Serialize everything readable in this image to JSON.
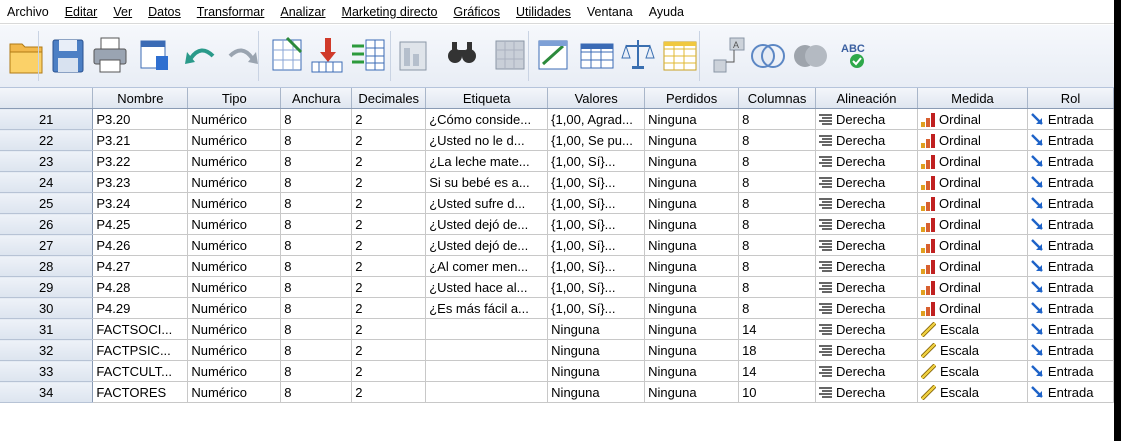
{
  "menu": [
    {
      "label": "Archivo",
      "ul": false
    },
    {
      "label": "Editar",
      "ul": true
    },
    {
      "label": "Ver",
      "ul": true
    },
    {
      "label": "Datos",
      "ul": true
    },
    {
      "label": "Transformar",
      "ul": true
    },
    {
      "label": "Analizar",
      "ul": true
    },
    {
      "label": "Marketing directo",
      "ul": true
    },
    {
      "label": "Gráficos",
      "ul": true
    },
    {
      "label": "Utilidades",
      "ul": true
    },
    {
      "label": "Ventana",
      "ul": false
    },
    {
      "label": "Ayuda",
      "ul": false
    }
  ],
  "toolbar": [
    "open-folder-icon",
    "save-icon",
    "print-icon",
    "dialog-recall-icon",
    "undo-icon",
    "redo-icon",
    "go-to-case-icon",
    "go-to-variable-icon",
    "variables-icon",
    "run-descriptive-icon",
    "find-icon",
    "insert-cases-icon",
    "insert-variable-icon",
    "split-file-icon",
    "weight-cases-icon",
    "select-cases-icon",
    "value-labels-icon",
    "use-variable-sets-icon",
    "show-all-variables-icon",
    "spell-check-icon"
  ],
  "grid": {
    "headers": [
      "",
      "Nombre",
      "Tipo",
      "Anchura",
      "Decimales",
      "Etiqueta",
      "Valores",
      "Perdidos",
      "Columnas",
      "Alineación",
      "Medida",
      "Rol"
    ],
    "rows": [
      {
        "n": "21",
        "nombre": "P3.20",
        "tipo": "Numérico",
        "anchura": "8",
        "decimales": "2",
        "etiqueta": "¿Cómo conside...",
        "valores": "{1,00, Agrad...",
        "perdidos": "Ninguna",
        "columnas": "8",
        "alineacion": "Derecha",
        "medida": "Ordinal",
        "rol": "Entrada"
      },
      {
        "n": "22",
        "nombre": "P3.21",
        "tipo": "Numérico",
        "anchura": "8",
        "decimales": "2",
        "etiqueta": "¿Usted no le d...",
        "valores": "{1,00, Se pu...",
        "perdidos": "Ninguna",
        "columnas": "8",
        "alineacion": "Derecha",
        "medida": "Ordinal",
        "rol": "Entrada"
      },
      {
        "n": "23",
        "nombre": "P3.22",
        "tipo": "Numérico",
        "anchura": "8",
        "decimales": "2",
        "etiqueta": "¿La leche mate...",
        "valores": "{1,00, Sí}...",
        "perdidos": "Ninguna",
        "columnas": "8",
        "alineacion": "Derecha",
        "medida": "Ordinal",
        "rol": "Entrada"
      },
      {
        "n": "24",
        "nombre": "P3.23",
        "tipo": "Numérico",
        "anchura": "8",
        "decimales": "2",
        "etiqueta": "Si su bebé es a...",
        "valores": "{1,00, Sí}...",
        "perdidos": "Ninguna",
        "columnas": "8",
        "alineacion": "Derecha",
        "medida": "Ordinal",
        "rol": "Entrada"
      },
      {
        "n": "25",
        "nombre": "P3.24",
        "tipo": "Numérico",
        "anchura": "8",
        "decimales": "2",
        "etiqueta": "¿Usted sufre d...",
        "valores": "{1,00, Sí}...",
        "perdidos": "Ninguna",
        "columnas": "8",
        "alineacion": "Derecha",
        "medida": "Ordinal",
        "rol": "Entrada"
      },
      {
        "n": "26",
        "nombre": "P4.25",
        "tipo": "Numérico",
        "anchura": "8",
        "decimales": "2",
        "etiqueta": "¿Usted dejó de...",
        "valores": "{1,00, Sí}...",
        "perdidos": "Ninguna",
        "columnas": "8",
        "alineacion": "Derecha",
        "medida": "Ordinal",
        "rol": "Entrada"
      },
      {
        "n": "27",
        "nombre": "P4.26",
        "tipo": "Numérico",
        "anchura": "8",
        "decimales": "2",
        "etiqueta": "¿Usted dejó de...",
        "valores": "{1,00, Sí}...",
        "perdidos": "Ninguna",
        "columnas": "8",
        "alineacion": "Derecha",
        "medida": "Ordinal",
        "rol": "Entrada"
      },
      {
        "n": "28",
        "nombre": "P4.27",
        "tipo": "Numérico",
        "anchura": "8",
        "decimales": "2",
        "etiqueta": "¿Al comer men...",
        "valores": "{1,00, Sí}...",
        "perdidos": "Ninguna",
        "columnas": "8",
        "alineacion": "Derecha",
        "medida": "Ordinal",
        "rol": "Entrada"
      },
      {
        "n": "29",
        "nombre": "P4.28",
        "tipo": "Numérico",
        "anchura": "8",
        "decimales": "2",
        "etiqueta": "¿Usted hace al...",
        "valores": "{1,00, Sí}...",
        "perdidos": "Ninguna",
        "columnas": "8",
        "alineacion": "Derecha",
        "medida": "Ordinal",
        "rol": "Entrada"
      },
      {
        "n": "30",
        "nombre": "P4.29",
        "tipo": "Numérico",
        "anchura": "8",
        "decimales": "2",
        "etiqueta": "¿Es más fácil a...",
        "valores": "{1,00, Sí}...",
        "perdidos": "Ninguna",
        "columnas": "8",
        "alineacion": "Derecha",
        "medida": "Ordinal",
        "rol": "Entrada"
      },
      {
        "n": "31",
        "nombre": "FACTSOCI...",
        "tipo": "Numérico",
        "anchura": "8",
        "decimales": "2",
        "etiqueta": "",
        "valores": "Ninguna",
        "perdidos": "Ninguna",
        "columnas": "14",
        "alineacion": "Derecha",
        "medida": "Escala",
        "rol": "Entrada"
      },
      {
        "n": "32",
        "nombre": "FACTPSIC...",
        "tipo": "Numérico",
        "anchura": "8",
        "decimales": "2",
        "etiqueta": "",
        "valores": "Ninguna",
        "perdidos": "Ninguna",
        "columnas": "18",
        "alineacion": "Derecha",
        "medida": "Escala",
        "rol": "Entrada"
      },
      {
        "n": "33",
        "nombre": "FACTCULT...",
        "tipo": "Numérico",
        "anchura": "8",
        "decimales": "2",
        "etiqueta": "",
        "valores": "Ninguna",
        "perdidos": "Ninguna",
        "columnas": "14",
        "alineacion": "Derecha",
        "medida": "Escala",
        "rol": "Entrada"
      },
      {
        "n": "34",
        "nombre": "FACTORES",
        "tipo": "Numérico",
        "anchura": "8",
        "decimales": "2",
        "etiqueta": "",
        "valores": "Ninguna",
        "perdidos": "Ninguna",
        "columnas": "10",
        "alineacion": "Derecha",
        "medida": "Escala",
        "rol": "Entrada"
      }
    ]
  }
}
